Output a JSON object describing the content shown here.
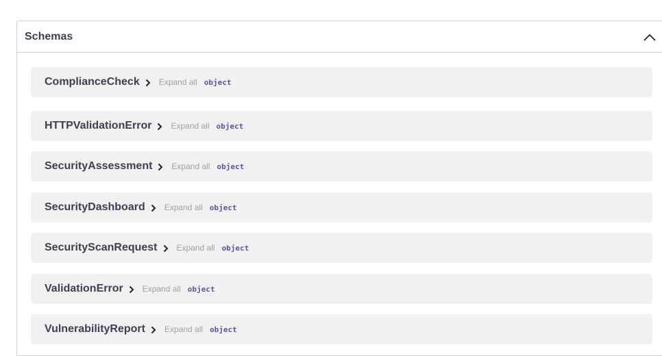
{
  "section": {
    "title": "Schemas",
    "toggle_icon": "chevron-up-icon"
  },
  "schemas": [
    {
      "name": "ComplianceCheck",
      "expand_label": "Expand all",
      "type": "object"
    },
    {
      "name": "HTTPValidationError",
      "expand_label": "Expand all",
      "type": "object"
    },
    {
      "name": "SecurityAssessment",
      "expand_label": "Expand all",
      "type": "object"
    },
    {
      "name": "SecurityDashboard",
      "expand_label": "Expand all",
      "type": "object"
    },
    {
      "name": "SecurityScanRequest",
      "expand_label": "Expand all",
      "type": "object"
    },
    {
      "name": "ValidationError",
      "expand_label": "Expand all",
      "type": "object"
    },
    {
      "name": "VulnerabilityReport",
      "expand_label": "Expand all",
      "type": "object"
    }
  ],
  "colors": {
    "model_background": "#f1f1f1",
    "type_text": "#5555aa",
    "expand_text": "#a0a0a0",
    "title_text": "#3b4151"
  }
}
